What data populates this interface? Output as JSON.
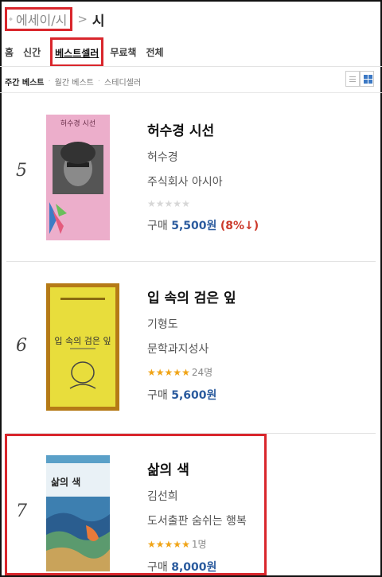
{
  "breadcrumb": {
    "parent": "에세이/시",
    "separator": ">",
    "current": "시"
  },
  "tabs": {
    "items": [
      "홈",
      "신간",
      "베스트셀러",
      "무료책",
      "전체"
    ],
    "selected": "베스트셀러"
  },
  "subtabs": {
    "items": [
      "주간 베스트",
      "월간 베스트",
      "스테디셀러"
    ],
    "selected": "주간 베스트"
  },
  "view_toggles": [
    "list-view-icon",
    "grid-view-icon"
  ],
  "books": [
    {
      "rank": "5",
      "title": "허수경 시선",
      "author": "허수경",
      "publisher": "주식회사 아시아",
      "rating_stars": 0,
      "review_count": "",
      "price_label": "구매",
      "price": "5,500원",
      "discount": "(8%↓)",
      "cover_text": "허수경 시선",
      "cover_bg": "#e9a6c3"
    },
    {
      "rank": "6",
      "title": "입 속의 검은 잎",
      "author": "기형도",
      "publisher": "문학과지성사",
      "rating_stars": 5,
      "review_count": "24명",
      "price_label": "구매",
      "price": "5,600원",
      "discount": "",
      "cover_text": "입 속의 검은 잎",
      "cover_bg": "#c68a1c"
    },
    {
      "rank": "7",
      "title": "삶의 색",
      "author": "김선희",
      "publisher": "도서출판 숨쉬는 행복",
      "rating_stars": 5,
      "review_count": "1명",
      "price_label": "구매",
      "price": "8,000원",
      "discount": "",
      "cover_text": "삶의 색",
      "cover_bg": "#5aa0c8"
    }
  ],
  "colors": {
    "highlight": "#d9262c",
    "price": "#2b5b9e",
    "star": "#f0a417",
    "discount": "#cc3a2b"
  }
}
